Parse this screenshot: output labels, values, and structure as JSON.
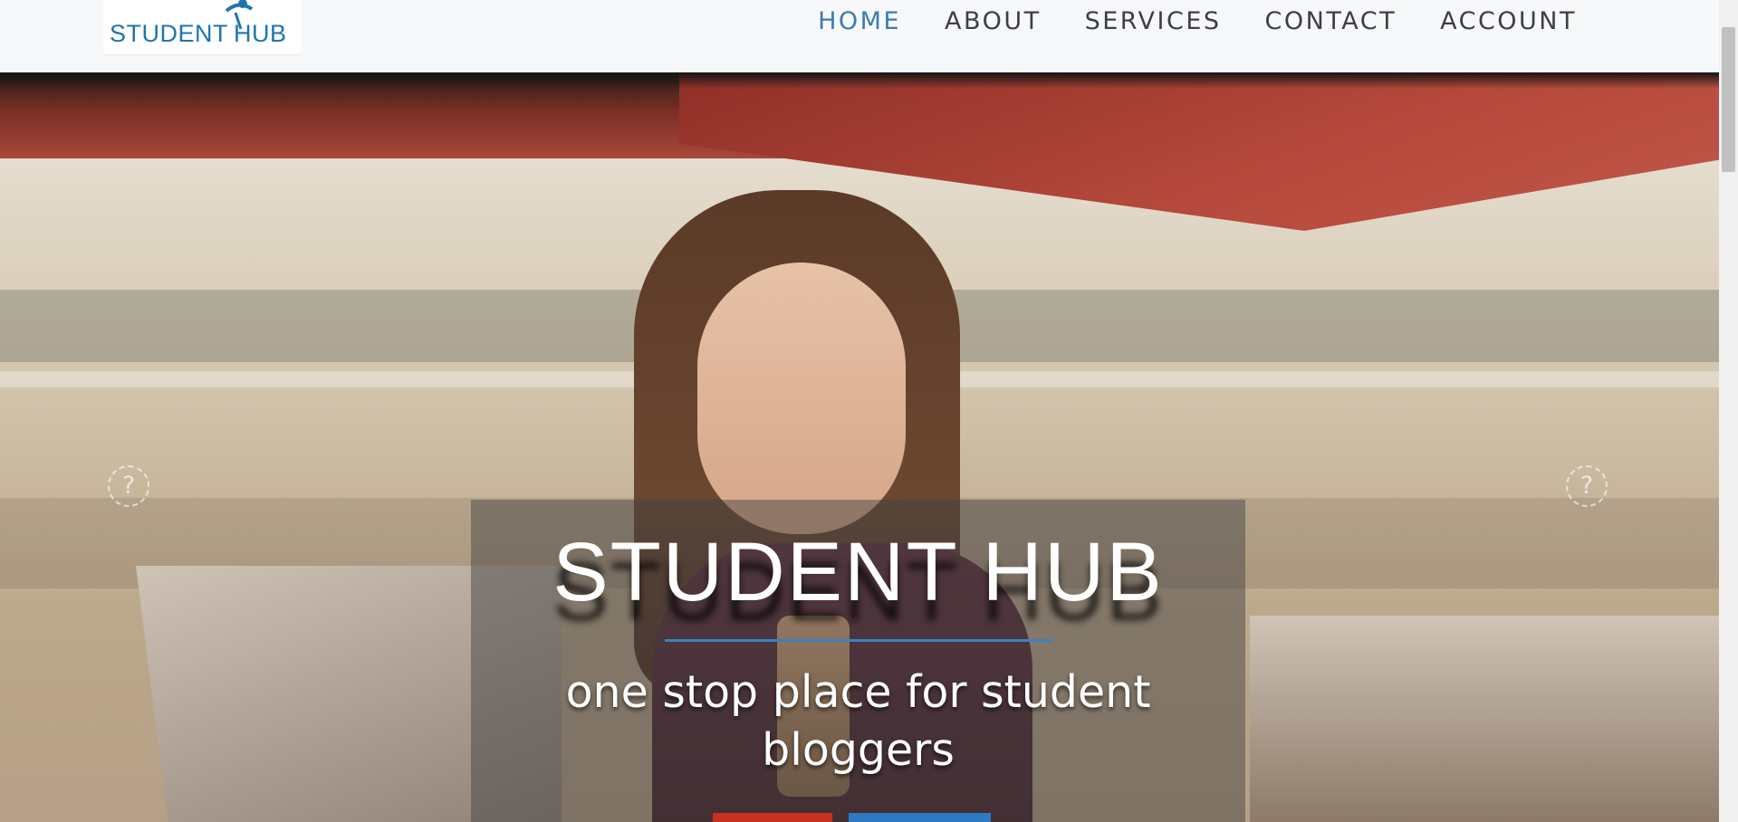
{
  "logo": {
    "text_left": "STUDENT",
    "text_right": "HUB"
  },
  "nav": {
    "items": [
      {
        "label": "HOME",
        "active": true
      },
      {
        "label": "ABOUT",
        "active": false
      },
      {
        "label": "SERVICES",
        "active": false
      },
      {
        "label": "CONTACT",
        "active": false
      },
      {
        "label": "ACCOUNT",
        "active": false
      }
    ]
  },
  "hero": {
    "title": "STUDENT HUB",
    "subtitle": "one stop place for student bloggers",
    "broken_icons": [
      "?",
      "?"
    ]
  },
  "colors": {
    "brand_blue": "#1f74b0",
    "nav_active": "#3a7bb8",
    "nav_text": "#3d3f42",
    "button_red": "#c6321f",
    "button_blue": "#2d79c4"
  }
}
